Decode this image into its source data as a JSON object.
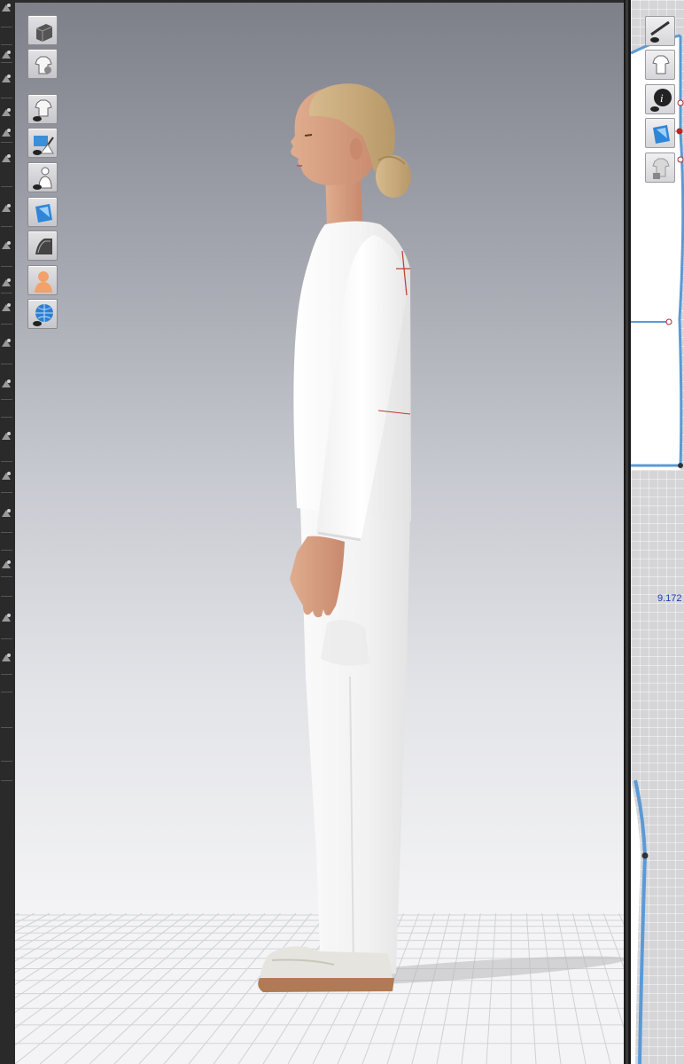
{
  "left_toolbar": {
    "tools": [
      {
        "icon": "avatar-edit-icon"
      },
      {
        "icon": "move-icon"
      },
      {
        "icon": "pen-icon"
      },
      {
        "icon": "brush-icon"
      },
      {
        "icon": "pin-icon"
      },
      {
        "icon": "brush-icon"
      },
      {
        "icon": "eraser-icon"
      },
      {
        "icon": "arrow-icon"
      },
      {
        "icon": "fold-icon"
      },
      {
        "icon": "circle-icon"
      },
      {
        "icon": "circle-icon"
      },
      {
        "icon": "layer-icon"
      },
      {
        "icon": "rectangle-icon"
      },
      {
        "icon": "cylinder-icon"
      },
      {
        "icon": "cylinder-icon"
      },
      {
        "icon": "square-icon"
      },
      {
        "icon": "square-icon"
      },
      {
        "icon": "arrow-left-icon"
      }
    ]
  },
  "viewport_3d": {
    "toolbar": [
      {
        "name": "simulation-cube-icon"
      },
      {
        "name": "garment-settings-icon"
      },
      {
        "name": "show-garment-icon"
      },
      {
        "name": "show-pins-icon"
      },
      {
        "name": "show-avatar-icon"
      },
      {
        "name": "texture-icon"
      },
      {
        "name": "surface-icon"
      },
      {
        "name": "avatar-skin-icon"
      },
      {
        "name": "render-globe-icon"
      }
    ],
    "background_top": "#7e8089",
    "background_bottom": "#f7f7f8",
    "garment_color": "#f3f3f3"
  },
  "pattern_window": {
    "toolbar": [
      {
        "name": "show-pattern-icon"
      },
      {
        "name": "pattern-garment-icon"
      },
      {
        "name": "info-icon"
      },
      {
        "name": "pattern-texture-icon"
      },
      {
        "name": "locked-garment-icon"
      }
    ],
    "measurement_label": "9.172",
    "pattern_outline_color": "#5b9ad6",
    "point_color": "#b02a2a"
  }
}
